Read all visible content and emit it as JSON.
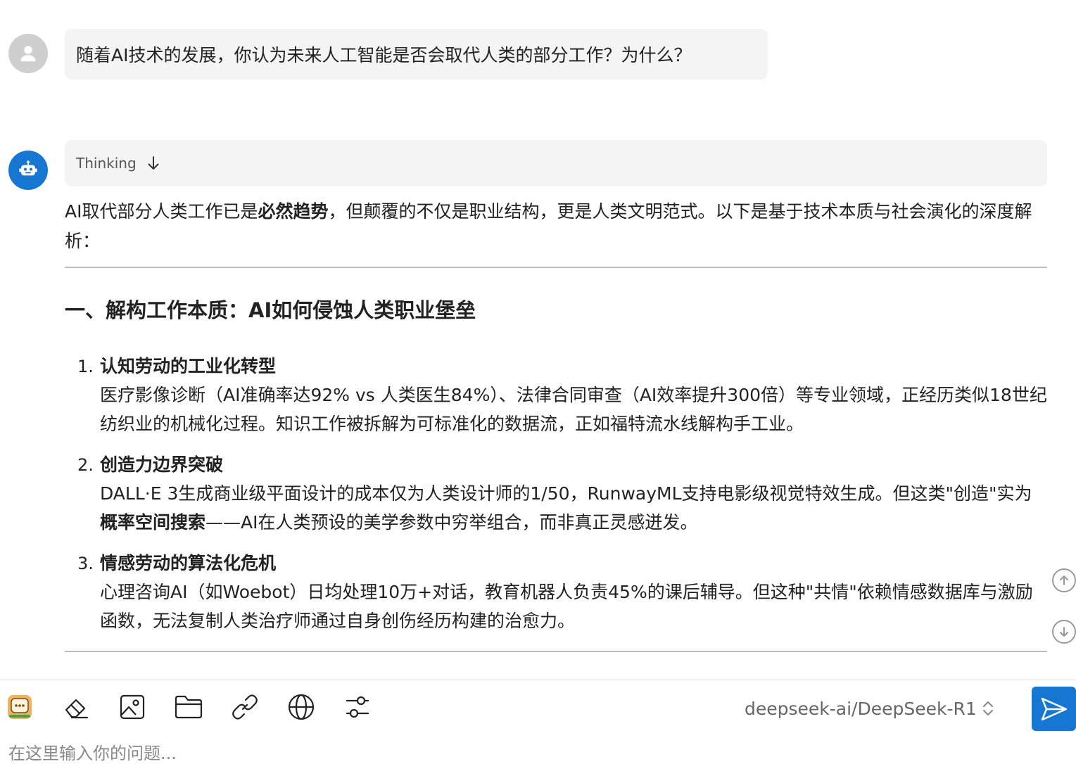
{
  "conversation": {
    "user_message": "随着AI技术的发展，你认为未来人工智能是否会取代人类的部分工作？为什么？",
    "thinking_label": "Thinking",
    "reply": {
      "intro_before": "AI取代部分人类工作已是",
      "intro_bold": "必然趋势",
      "intro_after": "，但颠覆的不仅是职业结构，更是人类文明范式。以下是基于技术本质与社会演化的深度解析：",
      "section_title": "一、解构工作本质：AI如何侵蚀人类职业堡垒",
      "items": [
        {
          "num": "1.",
          "head": "认知劳动的工业化转型",
          "body": "医疗影像诊断（AI准确率达92% vs 人类医生84%）、法律合同审查（AI效率提升300倍）等专业领域，正经历类似18世纪纺织业的机械化过程。知识工作被拆解为可标准化的数据流，正如福特流水线解构手工业。"
        },
        {
          "num": "2.",
          "head": "创造力边界突破",
          "body_before": "DALL·E 3生成商业级平面设计的成本仅为人类设计师的1/50，RunwayML支持电影级视觉特效生成。但这类\"创造\"实为",
          "body_bold": "概率空间搜索",
          "body_after": "——AI在人类预设的美学参数中穷举组合，而非真正灵感迸发。"
        },
        {
          "num": "3.",
          "head": "情感劳动的算法化危机",
          "body": "心理咨询AI（如Woebot）日均处理10万+对话，教育机器人负责45%的课后辅导。但这种\"共情\"依赖情感数据库与激励函数，无法复制人类治疗师通过自身创伤经历构建的治愈力。"
        }
      ]
    }
  },
  "toolbar": {
    "model_name": "deepseek-ai/DeepSeek-R1",
    "input_placeholder": "在这里输入你的问题...",
    "icons": [
      "chat-app-icon",
      "eraser-icon",
      "image-icon",
      "folder-icon",
      "link-icon",
      "globe-icon",
      "settings-sliders-icon"
    ]
  },
  "colors": {
    "accent": "#1677d2",
    "bubble_bg": "#f4f4f4",
    "user_avatar": "#cfcfcf"
  }
}
